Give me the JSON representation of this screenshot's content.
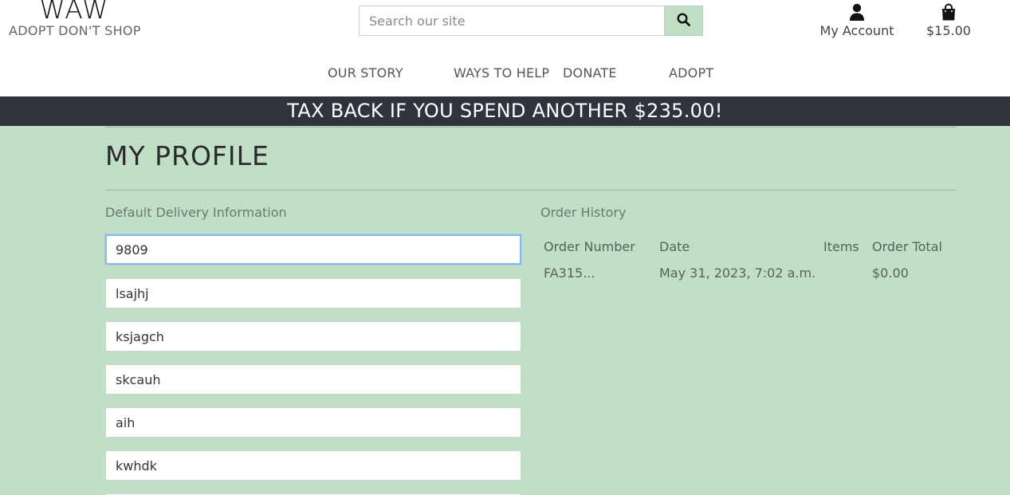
{
  "brand": {
    "name": "WAW",
    "tagline": "ADOPT DON'T SHOP"
  },
  "search": {
    "placeholder": "Search our site",
    "icon": "search-icon"
  },
  "account": {
    "label": "My Account",
    "icon": "user-icon"
  },
  "cart": {
    "label": "$15.00",
    "icon": "shopping-bag-icon"
  },
  "nav": {
    "items": [
      {
        "label": "OUR STORY"
      },
      {
        "label": "WAYS TO HELP"
      },
      {
        "label": "DONATE"
      },
      {
        "label": "ADOPT"
      }
    ]
  },
  "banner": {
    "text": "TAX BACK IF YOU SPEND ANOTHER $235.00!"
  },
  "profile": {
    "title": "MY PROFILE",
    "delivery": {
      "label": "Default Delivery Information",
      "fields": [
        {
          "value": "9809"
        },
        {
          "value": "lsajhj"
        },
        {
          "value": "ksjagch"
        },
        {
          "value": "skcauh"
        },
        {
          "value": "aih"
        },
        {
          "value": "kwhdk"
        }
      ]
    },
    "orders": {
      "label": "Order History",
      "columns": [
        "Order Number",
        "Date",
        "Items",
        "Order Total"
      ],
      "rows": [
        {
          "number": "FA315...",
          "date": "May 31, 2023, 7:02 a.m.",
          "items": "",
          "total": "$0.00"
        }
      ]
    }
  },
  "colors": {
    "main_bg": "#c0dfc6",
    "banner_bg": "#2f343c",
    "focus_ring": "#8db9e4"
  }
}
